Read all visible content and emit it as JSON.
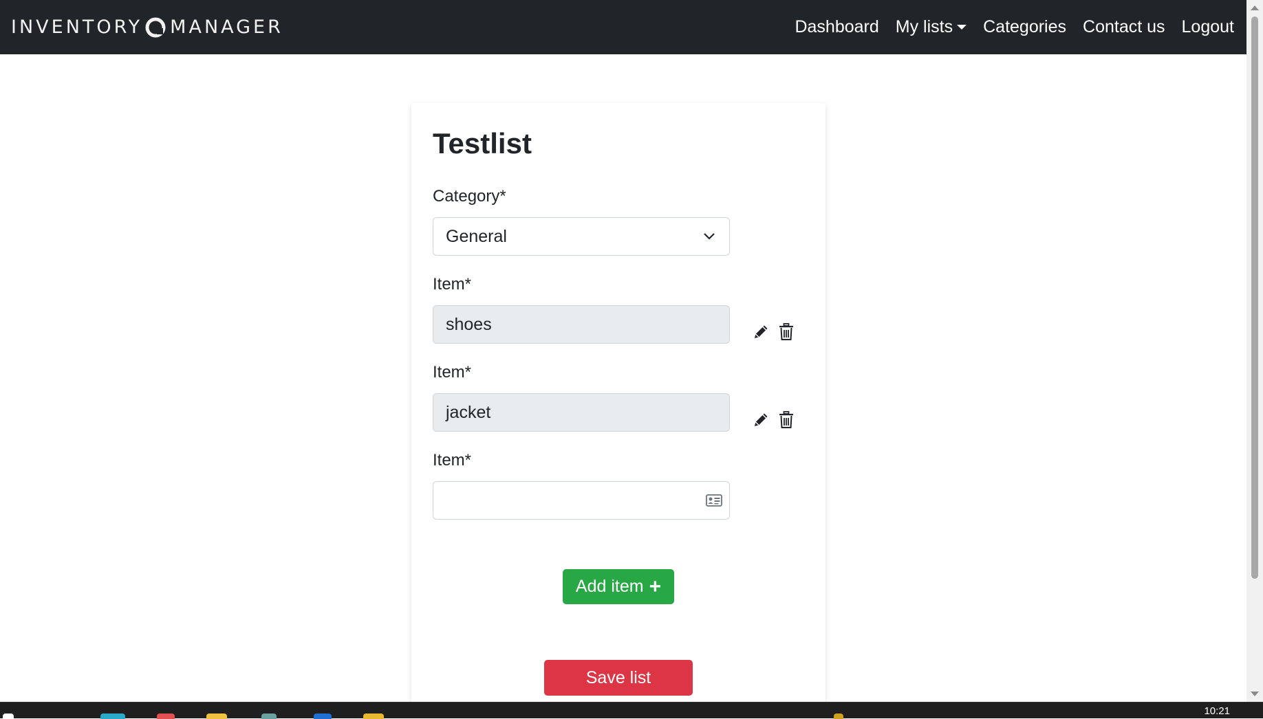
{
  "navbar": {
    "brand_left": "INVENTORY",
    "brand_right": "MANAGER",
    "links": [
      {
        "label": "Dashboard"
      },
      {
        "label": "My lists",
        "dropdown": true
      },
      {
        "label": "Categories"
      },
      {
        "label": "Contact us"
      },
      {
        "label": "Logout"
      }
    ]
  },
  "form": {
    "title": "Testlist",
    "category_label": "Category*",
    "category_value": "General",
    "items": [
      {
        "label": "Item*",
        "value": "shoes"
      },
      {
        "label": "Item*",
        "value": "jacket"
      },
      {
        "label": "Item*",
        "value": ""
      }
    ],
    "add_button": "Add item",
    "save_button": "Save list"
  },
  "colors": {
    "navbar_bg": "#212529",
    "add_button": "#28a745",
    "save_button": "#dc3545",
    "disabled_field": "#e9ecef"
  },
  "taskbar": {
    "clock": "10:21"
  }
}
